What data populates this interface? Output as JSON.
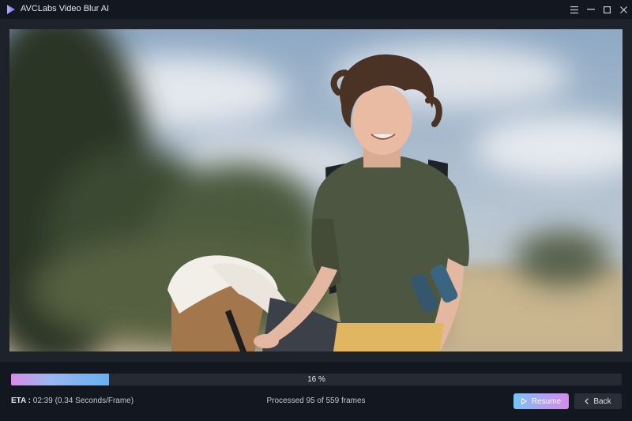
{
  "window": {
    "title": "AVCLabs Video Blur AI",
    "controls": [
      "menu-icon",
      "minimize-icon",
      "maximize-icon",
      "close-icon"
    ]
  },
  "progress": {
    "percent": 16,
    "label": "16 %"
  },
  "status": {
    "eta_label": "ETA :",
    "eta_value": "02:39 (0.34 Seconds/Frame)",
    "frames_text": "Processed 95 of 559 frames"
  },
  "actions": {
    "resume_label": "Resume",
    "back_label": "Back"
  },
  "colors": {
    "background": "#131720",
    "panel": "#1e222b",
    "progress_start": "#d88ce8",
    "progress_end": "#62b2f5"
  }
}
